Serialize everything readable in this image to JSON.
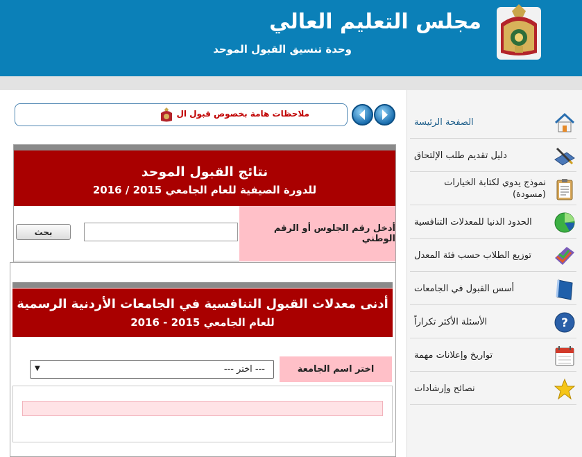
{
  "header": {
    "title": "مجلس التعليم العالي",
    "subtitle": "وحدة تنسيق القبول الموحد"
  },
  "ticker": {
    "text": "ملاحظات هامة بخصوص قبول ال"
  },
  "sidebar": {
    "items": [
      {
        "label": "الصفحة الرئيسة",
        "icon": "home-icon"
      },
      {
        "label": "دليل تقديم طلب الإلتحاق",
        "icon": "pen-book-icon"
      },
      {
        "label": "نموذج يدوي لكتابة الخيارات (مسودة)",
        "icon": "clipboard-icon"
      },
      {
        "label": "الحدود الدنيا للمعدلات التنافسية",
        "icon": "pie-chart-icon"
      },
      {
        "label": "توزيع الطلاب حسب فئة المعدل",
        "icon": "chart-icon"
      },
      {
        "label": "أسس القبول في الجامعات",
        "icon": "book-icon"
      },
      {
        "label": "الأسئلة الأكثر تكراراً",
        "icon": "question-icon"
      },
      {
        "label": "تواريخ وإعلانات مهمة",
        "icon": "calendar-icon"
      },
      {
        "label": "نصائح وإرشادات",
        "icon": "star-icon"
      }
    ]
  },
  "results_panel": {
    "title": "نتائج القبول الموحد",
    "subtitle": "للدورة الصيفية للعام الجامعي 2015 / 2016",
    "input_label": "أدخل رقم الجلوس أو الرقم الوطني",
    "input_value": "",
    "button_label": "بحث"
  },
  "rates_panel": {
    "title": "أدنى معدلات القبول التنافسية في الجامعات الأردنية الرسمية",
    "subtitle": "للعام الجامعي  2015  -  2016",
    "select_label": "اختر اسم الجامعة",
    "select_value": "--- اختر ---"
  },
  "colors": {
    "header_blue": "#0b80b8",
    "panel_red": "#a90000",
    "label_pink": "#ffc0c8",
    "ticker_red": "#c00000"
  }
}
